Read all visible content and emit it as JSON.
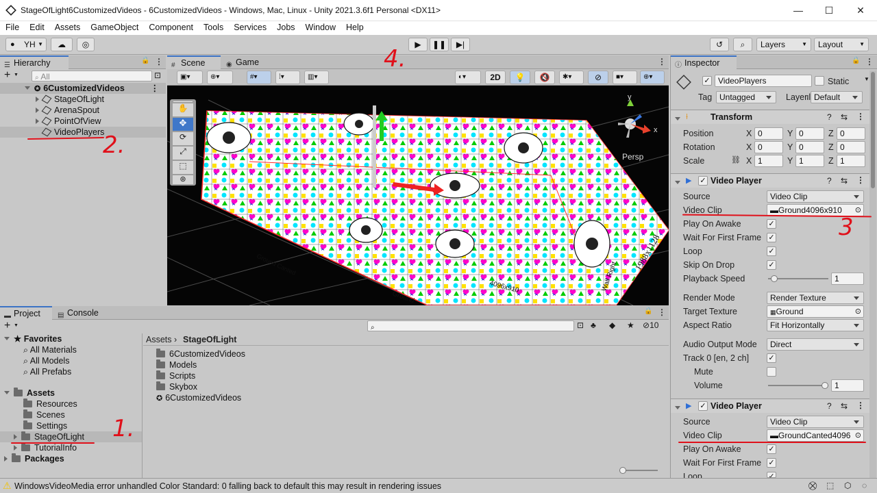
{
  "window": {
    "title": "StageOfLight6CustomizedVideos - 6CustomizedVideos - Windows, Mac, Linux - Unity 2021.3.6f1 Personal <DX11>",
    "controls": {
      "minimize": "—",
      "maximize": "☐",
      "close": "✕"
    }
  },
  "menu": [
    "File",
    "Edit",
    "Assets",
    "GameObject",
    "Component",
    "Tools",
    "Services",
    "Jobs",
    "Window",
    "Help"
  ],
  "toolbar": {
    "account": "YH",
    "layers": "Layers",
    "layout": "Layout"
  },
  "hierarchy": {
    "tab": "Hierarchy",
    "search_placeholder": "All",
    "scene": "6CustomizedVideos",
    "items": [
      "StageOfLight",
      "ArenaSpout",
      "PointOfView",
      "VideoPlayers"
    ]
  },
  "scene_view": {
    "tabs": [
      "Scene",
      "Game"
    ],
    "mode_2d": "2D",
    "persp": "Persp",
    "gizmo_axes": {
      "y": "y",
      "x": "x"
    }
  },
  "scene_texture_labels": [
    "Ground",
    "4096x910",
    "1988x1128",
    "Wall Right",
    "Ground Canted"
  ],
  "inspector": {
    "tab": "Inspector",
    "object_name": "VideoPlayers",
    "static_label": "Static",
    "tag_label": "Tag",
    "tag_value": "Untagged",
    "layer_label": "Layer",
    "layer_value": "Default",
    "transform": {
      "title": "Transform",
      "position": {
        "label": "Position",
        "x": "0",
        "y": "0",
        "z": "0"
      },
      "rotation": {
        "label": "Rotation",
        "x": "0",
        "y": "0",
        "z": "0"
      },
      "scale": {
        "label": "Scale",
        "x": "1",
        "y": "1",
        "z": "1"
      }
    },
    "video_player_1": {
      "title": "Video Player",
      "source_label": "Source",
      "source": "Video Clip",
      "clip_label": "Video Clip",
      "clip": "Ground4096x910",
      "play_on_awake": "Play On Awake",
      "wait_first_frame": "Wait For First Frame",
      "loop": "Loop",
      "skip_on_drop": "Skip On Drop",
      "playback_speed_label": "Playback Speed",
      "playback_speed": "1",
      "render_mode_label": "Render Mode",
      "render_mode": "Render Texture",
      "target_texture_label": "Target Texture",
      "target_texture": "Ground",
      "aspect_ratio_label": "Aspect Ratio",
      "aspect_ratio": "Fit Horizontally",
      "audio_output_label": "Audio Output Mode",
      "audio_output": "Direct",
      "track_label": "Track 0 [en, 2 ch]",
      "mute_label": "Mute",
      "volume_label": "Volume",
      "volume": "1"
    },
    "video_player_2": {
      "title": "Video Player",
      "source_label": "Source",
      "source": "Video Clip",
      "clip_label": "Video Clip",
      "clip": "GroundCanted4096",
      "play_on_awake": "Play On Awake",
      "wait_first_frame": "Wait For First Frame",
      "loop": "Loop"
    }
  },
  "project": {
    "tabs": [
      "Project",
      "Console"
    ],
    "hidden_count": "10",
    "favorites": {
      "title": "Favorites",
      "items": [
        "All Materials",
        "All Models",
        "All Prefabs"
      ]
    },
    "assets": {
      "title": "Assets",
      "items": [
        "Resources",
        "Scenes",
        "Settings",
        "StageOfLight",
        "TutorialInfo"
      ]
    },
    "packages": "Packages",
    "breadcrumb": [
      "Assets",
      "StageOfLight"
    ],
    "contents": [
      "6CustomizedVideos",
      "Models",
      "Scripts",
      "Skybox",
      "6CustomizedVideos"
    ]
  },
  "status": {
    "message": "WindowsVideoMedia error unhandled Color Standard: 0  falling back to default this may result in rendering issues"
  },
  "annotations": [
    "1.",
    "2.",
    "3",
    "4."
  ],
  "colors": {
    "annotation_red": "#e0101a",
    "accent_blue": "#3a72c5",
    "warning_yellow": "#f2c200"
  }
}
